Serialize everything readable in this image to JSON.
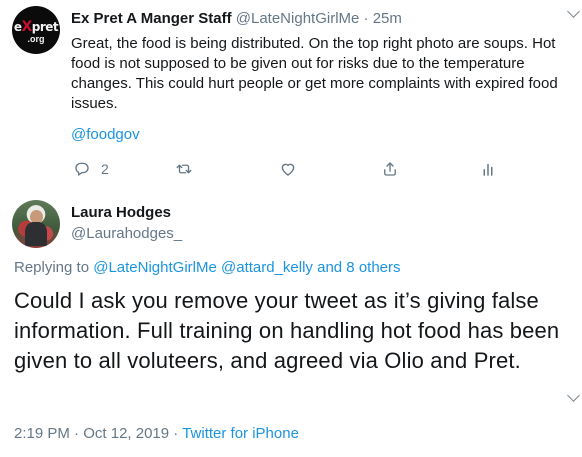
{
  "tweet1": {
    "avatar": {
      "logo_top": "eXpret",
      "logo_bottom": ".org"
    },
    "author_name": "Ex Pret A Manger Staff",
    "author_handle": "@LateNightGirlMe",
    "separator": "·",
    "time": "25m",
    "text": "Great, the food is being distributed. On the top right photo are soups. Hot food is not supposed to be given out for risks due to the temperature changes. This could hurt people or get more complaints with expired food issues.",
    "link": "@foodgov",
    "actions": {
      "reply_icon": "reply-icon",
      "reply_count": "2",
      "retweet_icon": "retweet-icon",
      "like_icon": "like-icon",
      "share_icon": "share-icon",
      "analytics_icon": "analytics-icon"
    }
  },
  "tweet2": {
    "author_name": "Laura Hodges",
    "author_handle": "@Laurahodges_",
    "replying_prefix": "Replying to",
    "replying_mentions": [
      "@LateNightGirlMe",
      "@attard_kelly"
    ],
    "replying_suffix": "and 8 others",
    "text": "Could I ask you remove your tweet as it’s giving false information. Full training on handling hot food has been given to all voluteers, and agreed via Olio and Pret.",
    "time": "2:19 PM",
    "separator": "·",
    "date": "Oct 12, 2019",
    "source": "Twitter for iPhone"
  },
  "colors": {
    "link": "#1b95e0",
    "muted": "#657786",
    "text": "#14171a"
  }
}
